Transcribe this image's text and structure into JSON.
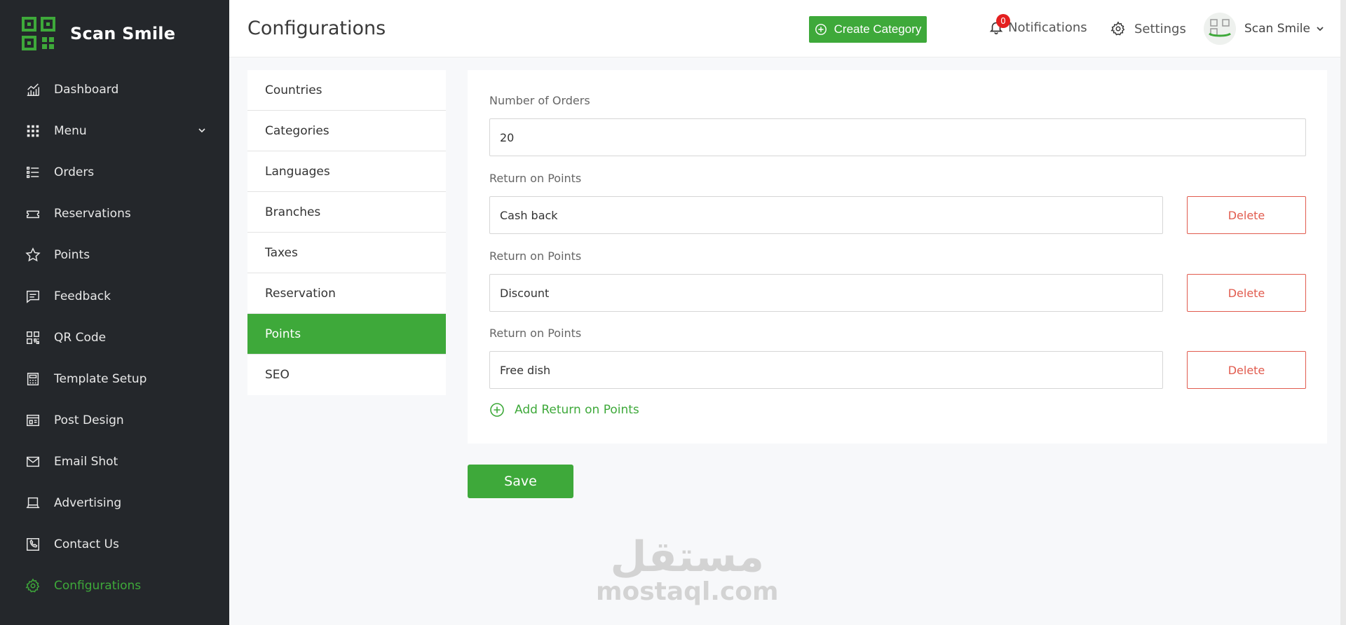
{
  "brand": {
    "name": "Scan Smile"
  },
  "sidebar": {
    "items": [
      {
        "label": "Dashboard",
        "icon": "chart-icon"
      },
      {
        "label": "Menu",
        "icon": "grid-icon",
        "has_children": true
      },
      {
        "label": "Orders",
        "icon": "list-icon"
      },
      {
        "label": "Reservations",
        "icon": "ticket-icon"
      },
      {
        "label": "Points",
        "icon": "star-icon"
      },
      {
        "label": "Feedback",
        "icon": "comment-icon"
      },
      {
        "label": "QR Code",
        "icon": "qr-icon"
      },
      {
        "label": "Template Setup",
        "icon": "calculator-icon"
      },
      {
        "label": "Post Design",
        "icon": "layout-icon"
      },
      {
        "label": "Email Shot",
        "icon": "mail-icon"
      },
      {
        "label": "Advertising",
        "icon": "laptop-icon"
      },
      {
        "label": "Contact Us",
        "icon": "phone-icon"
      },
      {
        "label": "Configurations",
        "icon": "gear-icon",
        "active": true
      }
    ]
  },
  "header": {
    "title": "Configurations",
    "create_label": "Create Category",
    "notifications_label": "Notifications",
    "notifications_count": "0",
    "settings_label": "Settings",
    "user_name": "Scan Smile"
  },
  "config_menu": {
    "items": [
      "Countries",
      "Categories",
      "Languages",
      "Branches",
      "Taxes",
      "Reservation",
      "Points",
      "SEO"
    ],
    "active": "Points"
  },
  "form": {
    "orders_label": "Number of Orders",
    "orders_value": "20",
    "returns": [
      {
        "label": "Return on Points",
        "value": "Cash back",
        "delete_label": "Delete"
      },
      {
        "label": "Return on Points",
        "value": "Discount",
        "delete_label": "Delete"
      },
      {
        "label": "Return on Points",
        "value": "Free dish",
        "delete_label": "Delete"
      }
    ],
    "add_label": "Add Return on Points",
    "save_label": "Save"
  },
  "watermark": {
    "arabic": "مستقل",
    "latin": "mostaql.com"
  },
  "colors": {
    "sidebar_bg": "#24272b",
    "accent": "#3ea93a",
    "danger": "#e15b4e",
    "badge": "#e41f1f",
    "page_bg": "#f7f8fa"
  }
}
